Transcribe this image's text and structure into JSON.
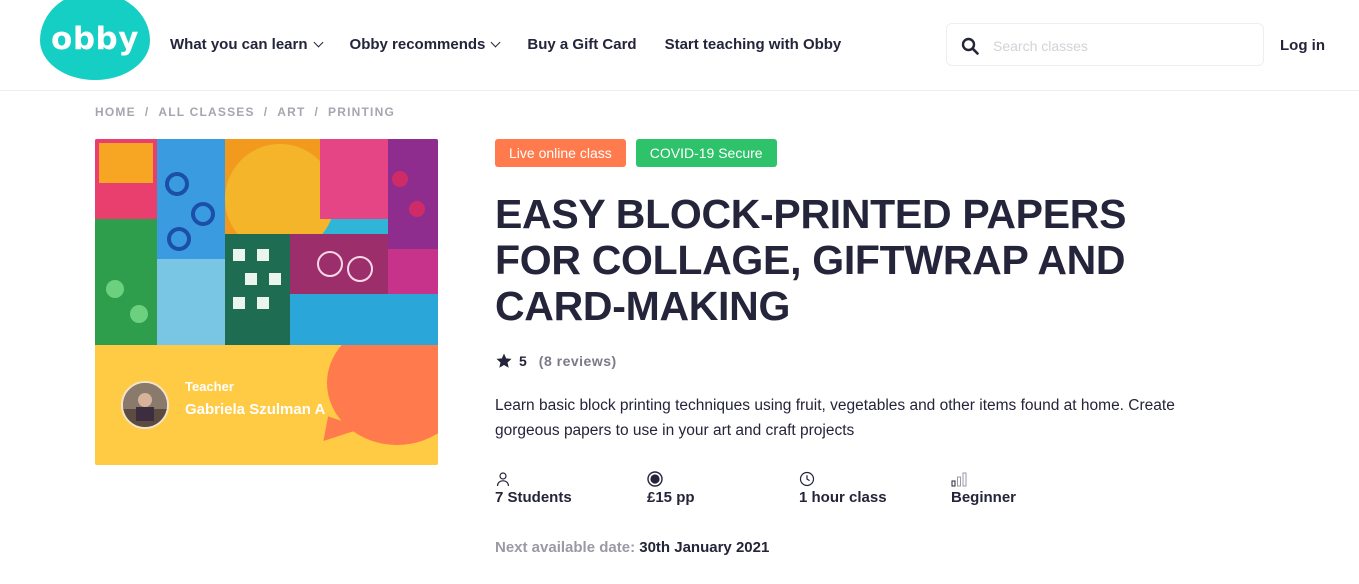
{
  "brand": {
    "logo_text": "obby",
    "accent": "#16cfc4"
  },
  "nav": {
    "items": [
      {
        "label": "What you can learn",
        "has_dropdown": true
      },
      {
        "label": "Obby recommends",
        "has_dropdown": true
      },
      {
        "label": "Buy a Gift Card",
        "has_dropdown": false
      },
      {
        "label": "Start teaching with Obby",
        "has_dropdown": false
      }
    ],
    "search_placeholder": "Search classes",
    "login_label": "Log in"
  },
  "breadcrumb": [
    "HOME",
    "ALL CLASSES",
    "ART",
    "PRINTING"
  ],
  "teacher": {
    "label": "Teacher",
    "name": "Gabriela Szulman A"
  },
  "tags": [
    {
      "label": "Live online class",
      "color": "#ff7a4d"
    },
    {
      "label": "COVID-19 Secure",
      "color": "#2ec26a"
    }
  ],
  "course": {
    "title": "EASY BLOCK-PRINTED PAPERS FOR COLLAGE, GIFTWRAP AND CARD-MAKING",
    "rating": "5",
    "reviews": "(8 reviews)",
    "description": "Learn basic block printing techniques using fruit, vegetables and other items found at home. Create gorgeous papers to use in your art and craft projects"
  },
  "stats": [
    {
      "icon": "person-icon",
      "value": "7 Students"
    },
    {
      "icon": "pound-icon",
      "value": "£15 pp"
    },
    {
      "icon": "clock-icon",
      "value": "1 hour class"
    },
    {
      "icon": "level-bars-icon",
      "value": "Beginner"
    }
  ],
  "next_date": {
    "label": "Next available date:",
    "value": "30th January 2021"
  }
}
